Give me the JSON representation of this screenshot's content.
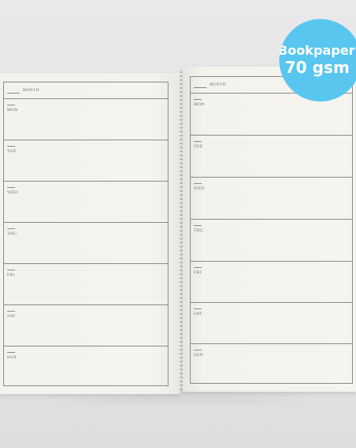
{
  "badge": {
    "line1": "Bookpaper",
    "line2": "70 gsm",
    "color": "#58c6ef"
  },
  "left_page": {
    "month_label": "MONTH",
    "days": [
      "MON",
      "TUE",
      "WED",
      "THU",
      "FRI",
      "SAT",
      "SUN"
    ]
  },
  "right_page": {
    "month_label": "MONTH",
    "days": [
      "MON",
      "TUE",
      "WED",
      "THU",
      "FRI",
      "SAT",
      "SUN"
    ]
  }
}
